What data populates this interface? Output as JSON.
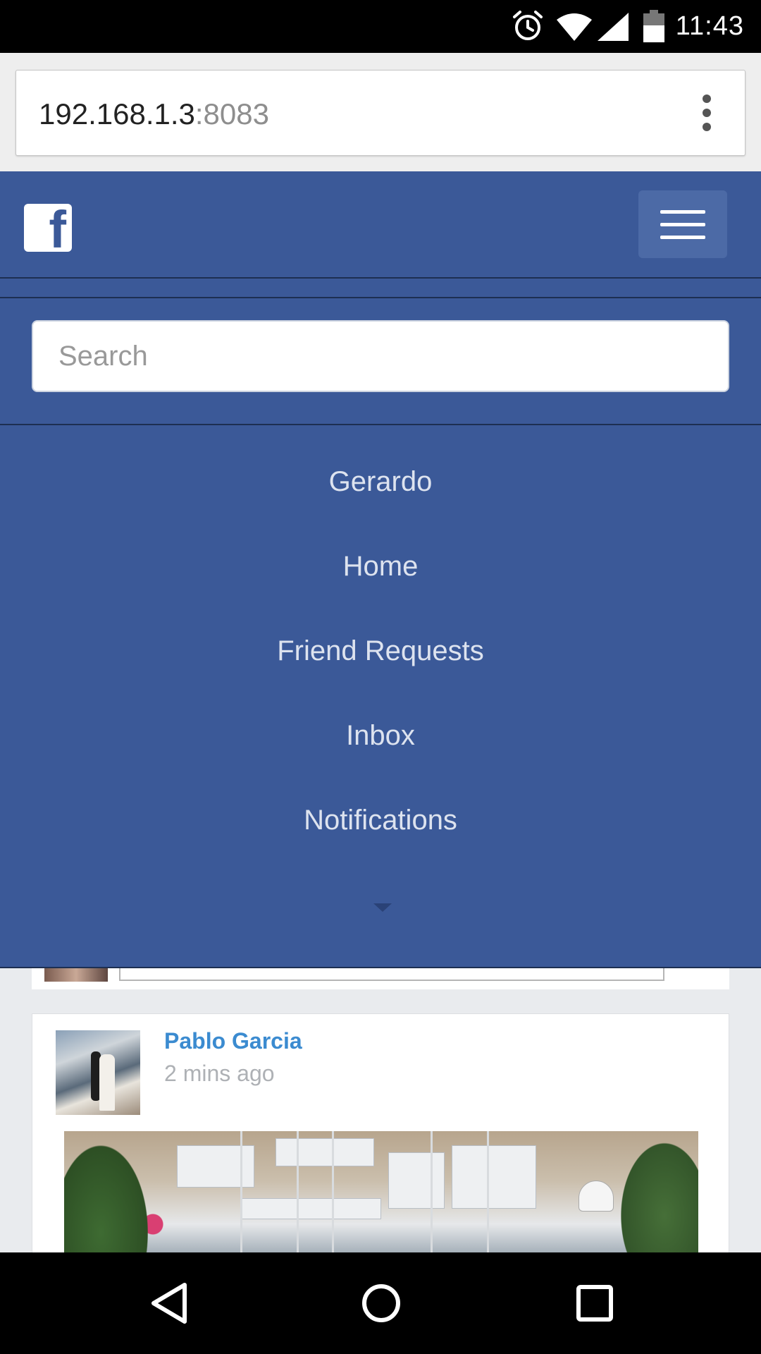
{
  "status_bar": {
    "time": "11:43",
    "icons": [
      "alarm-icon",
      "wifi-icon",
      "signal-icon",
      "battery-icon"
    ]
  },
  "browser": {
    "url_host": "192.168.1.3",
    "url_port": ":8083",
    "menu_icon": "more-vert-icon"
  },
  "navbar": {
    "logo_letter": "f",
    "logo_icon": "facebook-logo-icon",
    "toggle_icon": "hamburger-menu-icon"
  },
  "search": {
    "placeholder": "Search",
    "value": ""
  },
  "menu": {
    "items": [
      {
        "label": "Gerardo"
      },
      {
        "label": "Home"
      },
      {
        "label": "Friend Requests"
      },
      {
        "label": "Inbox"
      },
      {
        "label": "Notifications"
      }
    ],
    "more_icon": "caret-down-icon"
  },
  "post": {
    "author": "Pablo Garcia",
    "time": "2 mins ago"
  },
  "colors": {
    "brand": "#3b5998",
    "link": "#3b8bd0",
    "menu_text": "#dde3ef"
  },
  "system_nav": {
    "icons": [
      "back-icon",
      "home-icon",
      "recents-icon"
    ]
  }
}
